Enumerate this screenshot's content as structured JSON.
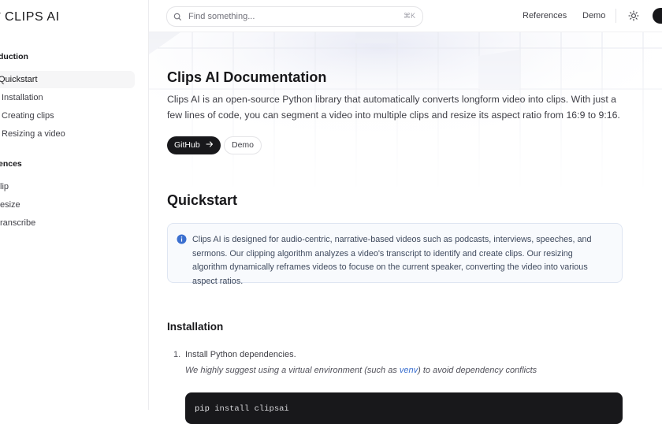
{
  "app": {
    "logo_text": "CLIPS AI"
  },
  "sidebar": {
    "groups": [
      {
        "label": "duction"
      },
      {
        "label": "ences"
      }
    ],
    "items": [
      {
        "label": "Quickstart"
      },
      {
        "label": "Installation"
      },
      {
        "label": "Creating clips"
      },
      {
        "label": "Resizing a video"
      },
      {
        "label": "lip"
      },
      {
        "label": "esize"
      },
      {
        "label": "ranscribe"
      }
    ]
  },
  "header": {
    "search_placeholder": "Find something...",
    "search_shortcut": "⌘K",
    "nav": [
      "References",
      "Demo"
    ]
  },
  "hero": {
    "title": "Clips AI Documentation",
    "lead": "Clips AI is an open-source Python library that automatically converts longform video into clips. With just a few lines of code, you can segment a video into multiple clips and resize its aspect ratio from 16:9 to 9:16.",
    "buttons": {
      "github": "GitHub",
      "demo": "Demo"
    }
  },
  "quickstart": {
    "title": "Quickstart",
    "note": "Clips AI is designed for audio-centric, narrative-based videos such as podcasts, interviews, speeches, and sermons. Our clipping algorithm analyzes a video's transcript to identify and create clips. Our resizing algorithm dynamically reframes videos to focuse on the current speaker, converting the video into various aspect ratios."
  },
  "installation": {
    "title": "Installation",
    "step_number": "1.",
    "step_text": "Install Python dependencies.",
    "hint_before": "We highly suggest using a virtual environment (such as ",
    "hint_link": "venv",
    "hint_after": ") to avoid dependency conflicts",
    "code": {
      "cmd": "pip",
      "args": "install clipsai"
    }
  },
  "colors": {
    "text": "#18181b",
    "muted": "#3f3f46",
    "accent_link": "#3b6fcf",
    "note_bg": "#f8fafd",
    "code_bg": "#18181b"
  }
}
